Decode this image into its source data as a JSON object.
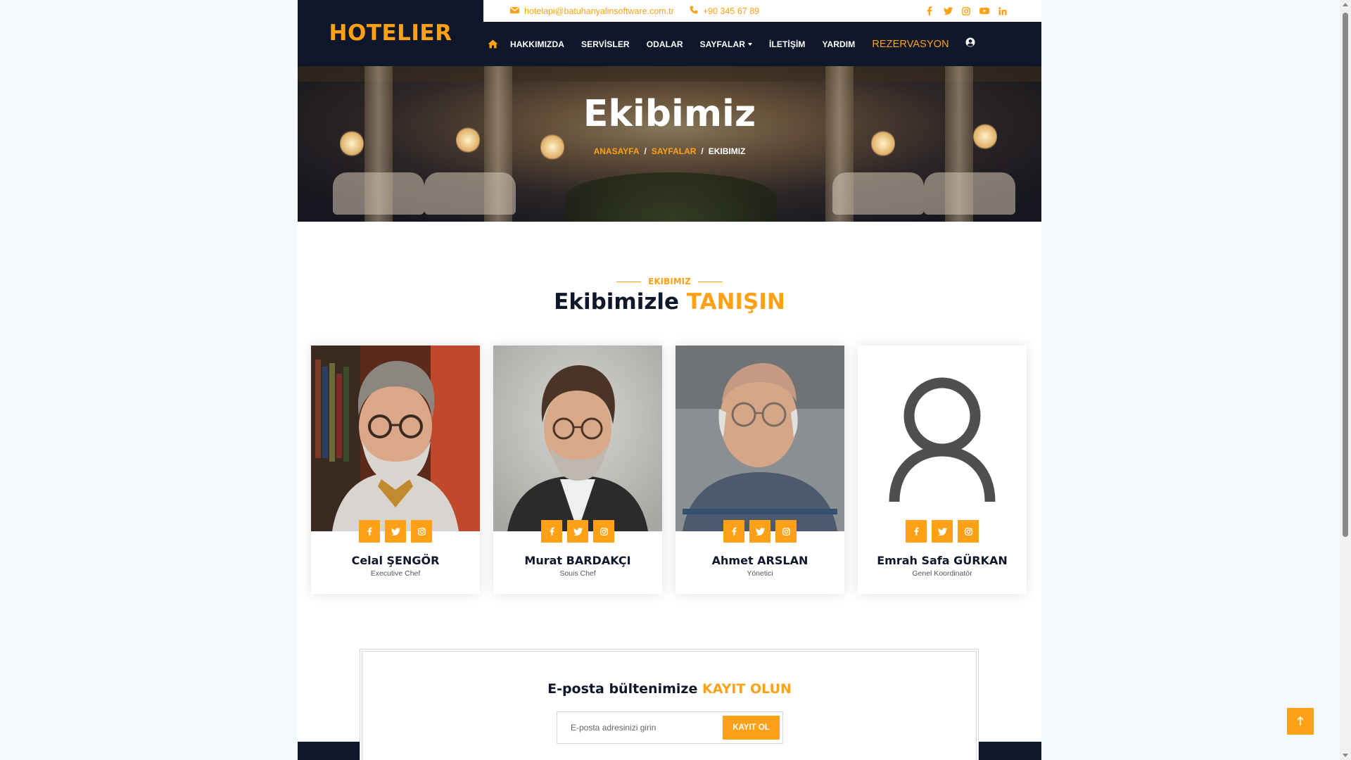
{
  "brand": {
    "logo": "HOTELIER",
    "accent": "#fea116",
    "dark": "#0f172b"
  },
  "topbar": {
    "email": "hotelapi@batuhanyalinsoftware.com.tr",
    "phone": "+90 345 67 89",
    "socials": [
      "facebook-icon",
      "twitter-icon",
      "instagram-icon",
      "youtube-icon",
      "linkedin-icon"
    ]
  },
  "nav": {
    "items": [
      "HAKKIMIZDA",
      "SERVİSLER",
      "ODALAR",
      "SAYFALAR",
      "İLETİŞİM",
      "YARDIM"
    ],
    "reservation": "REZERVASYON"
  },
  "hero": {
    "title": "Ekibimiz",
    "breadcrumb": [
      "ANASAYFA",
      "SAYFALAR",
      "EKIBIMIZ"
    ]
  },
  "team_section": {
    "tag": "EKIBIMIZ",
    "title_main": "Ekibimizle",
    "title_accent": "TANIŞIN",
    "members": [
      {
        "name": "Celal ŞENGÖR",
        "role": "Executive Chef"
      },
      {
        "name": "Murat BARDAKÇI",
        "role": "Souis Chef"
      },
      {
        "name": "Ahmet ARSLAN",
        "role": "Yönetici"
      },
      {
        "name": "Emrah Safa GÜRKAN",
        "role": "Genel Koordinatör"
      }
    ]
  },
  "newsletter": {
    "title_main": "E-posta bültenimize",
    "title_accent": "KAYIT OLUN",
    "placeholder": "E-posta adresinizi girin",
    "button": "KAYIT OL"
  }
}
